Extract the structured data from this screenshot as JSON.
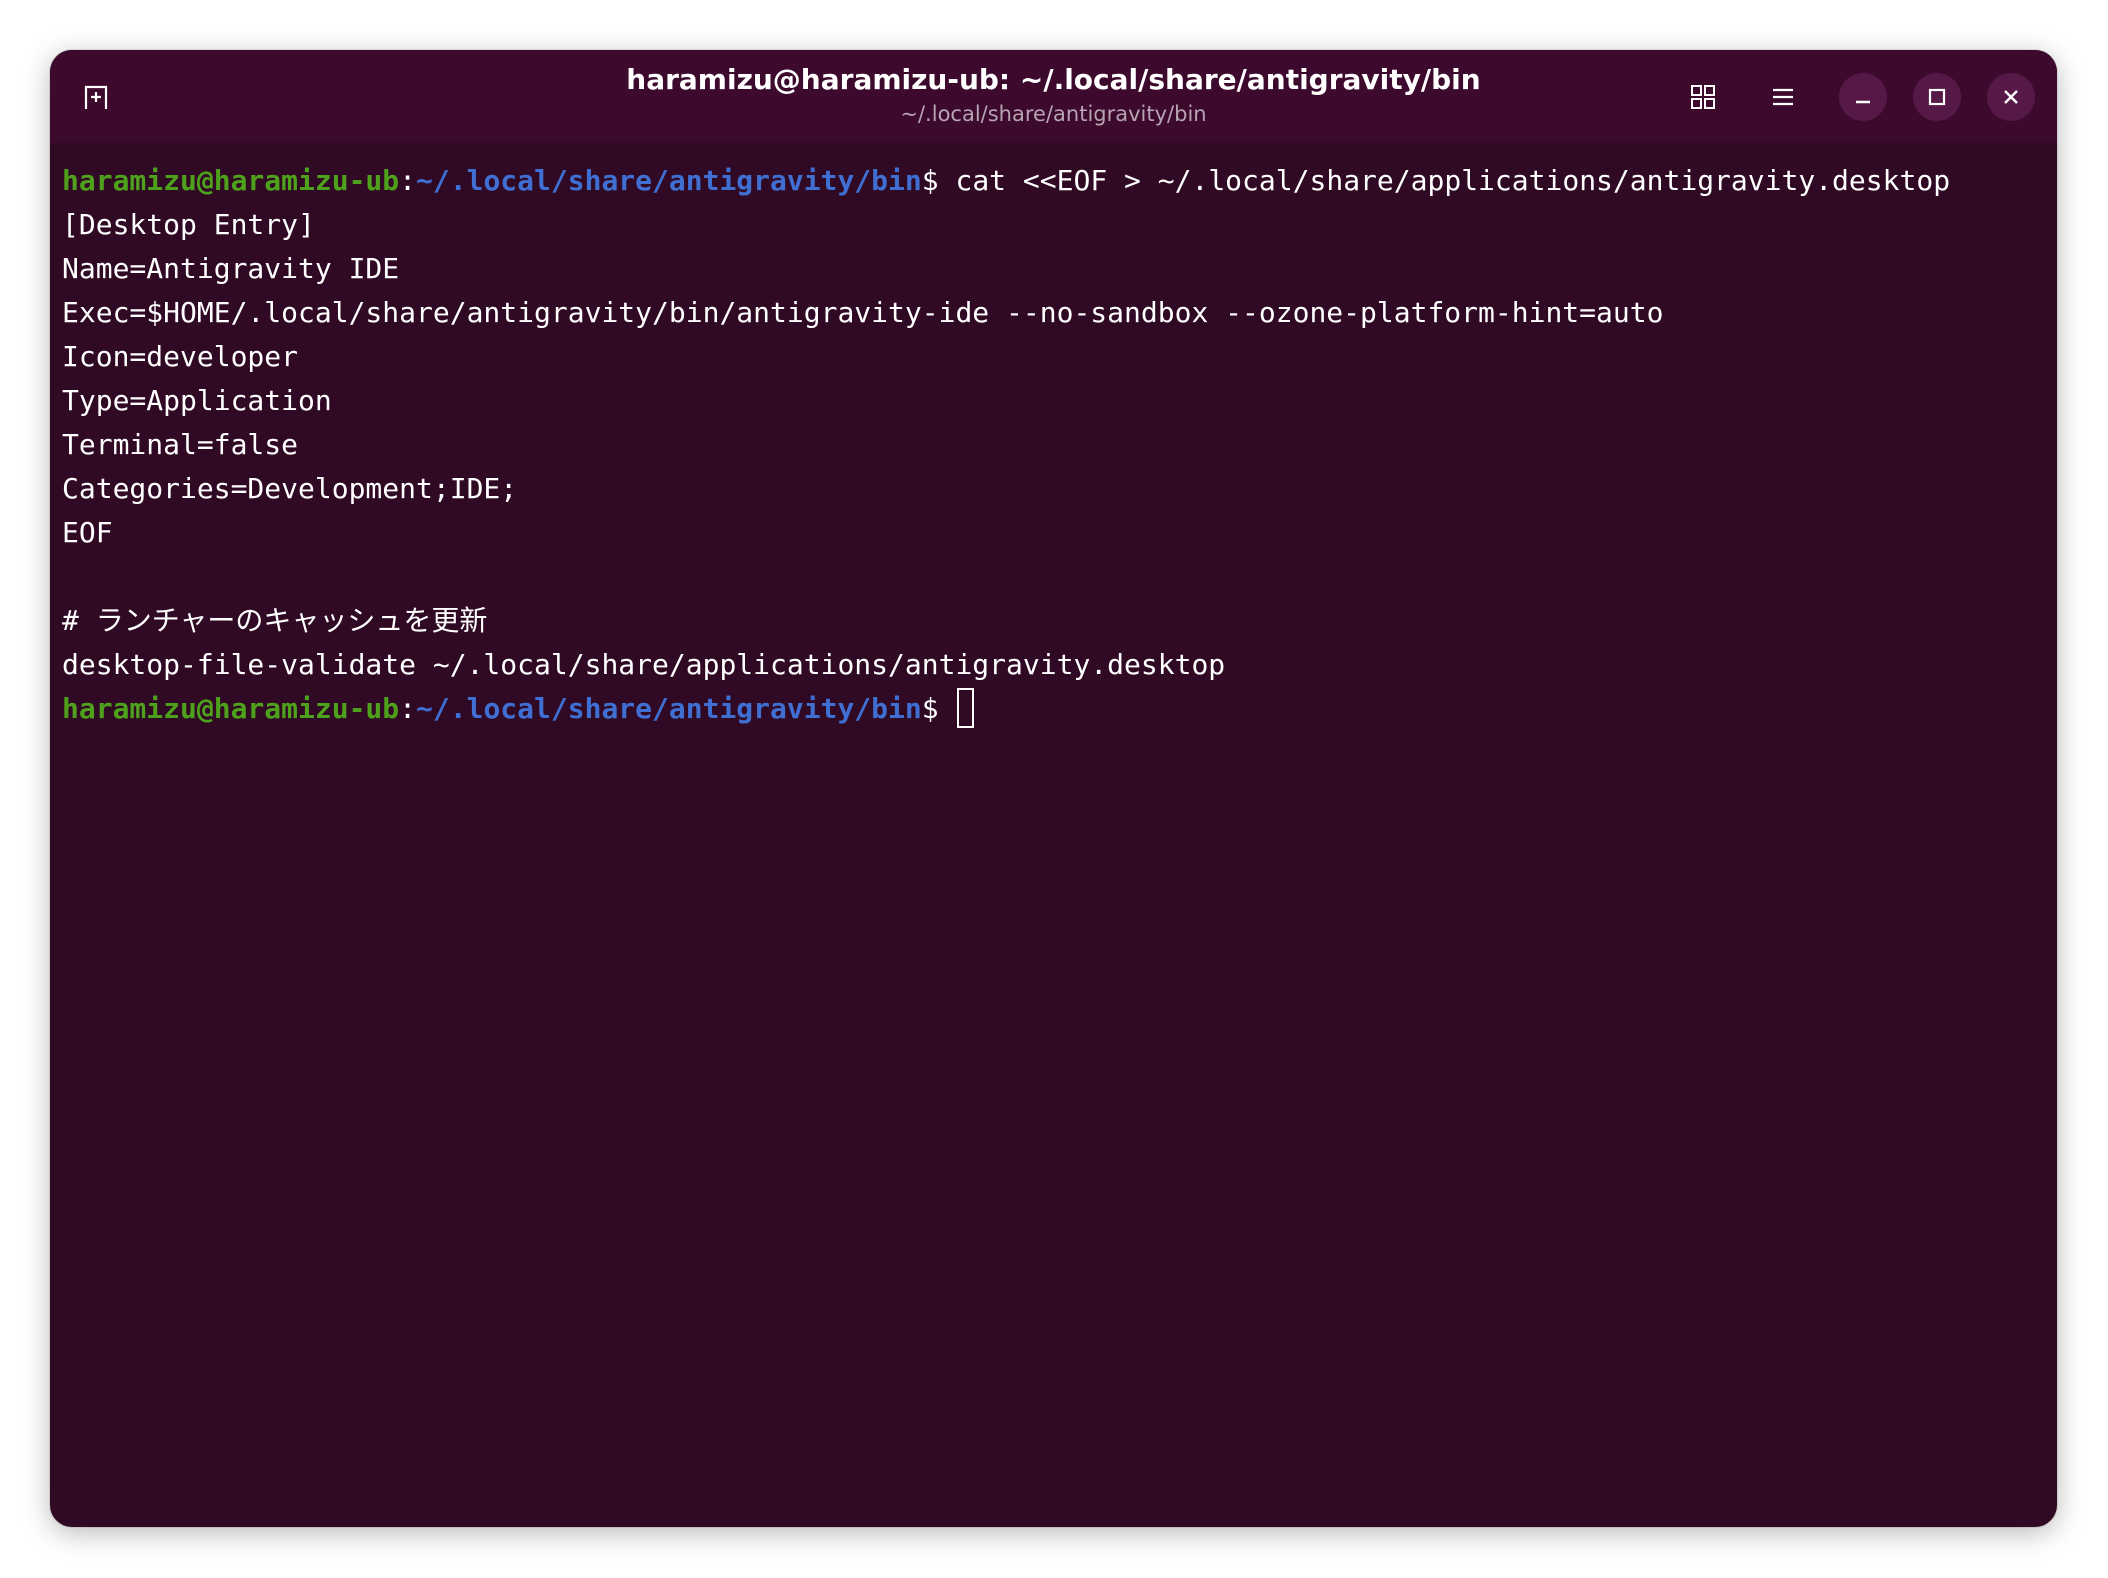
{
  "window": {
    "title": "haramizu@haramizu-ub: ~/.local/share/antigravity/bin",
    "subtitle": "~/.local/share/antigravity/bin",
    "icons": {
      "new_tab": "new-tab-icon",
      "view": "grid-icon",
      "menu": "hamburger-menu-icon",
      "minimize": "minimize-icon",
      "maximize": "maximize-icon",
      "close": "close-icon"
    }
  },
  "prompt": {
    "user_host": "haramizu@haramizu-ub",
    "colon": ":",
    "path": "~/.local/share/antigravity/bin",
    "dollar": "$"
  },
  "terminal": {
    "command1": " cat <<EOF > ~/.local/share/applications/antigravity.desktop",
    "output_lines": [
      "[Desktop Entry]",
      "Name=Antigravity IDE",
      "Exec=$HOME/.local/share/antigravity/bin/antigravity-ide --no-sandbox --ozone-platform-hint=auto",
      "Icon=developer",
      "Type=Application",
      "Terminal=false",
      "Categories=Development;IDE;",
      "EOF",
      "",
      "# ランチャーのキャッシュを更新",
      "desktop-file-validate ~/.local/share/applications/antigravity.desktop"
    ]
  },
  "colors": {
    "background": "#300a24",
    "titlebar": "#3d0a2e",
    "user_host": "#4ea11a",
    "path": "#3f6fd2",
    "text": "#ffffff"
  }
}
